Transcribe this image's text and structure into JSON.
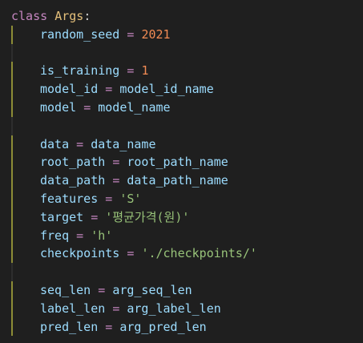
{
  "colors": {
    "background": "#1f1f1f",
    "keyword": "#c586c0",
    "class_name": "#e5c07b",
    "variable": "#9cdcfe",
    "number": "#f28b54",
    "string": "#98c379",
    "indent_guide": "#8c8c36"
  },
  "header": {
    "keyword": "class",
    "name": "Args",
    "colon": ":"
  },
  "lines": [
    {
      "name": "random_seed",
      "value": "2021",
      "type": "num"
    },
    null,
    {
      "name": "is_training",
      "value": "1",
      "type": "num"
    },
    {
      "name": "model_id",
      "value": "model_id_name",
      "type": "var"
    },
    {
      "name": "model",
      "value": "model_name",
      "type": "var"
    },
    null,
    {
      "name": "data",
      "value": "data_name",
      "type": "var"
    },
    {
      "name": "root_path",
      "value": "root_path_name",
      "type": "var"
    },
    {
      "name": "data_path",
      "value": "data_path_name",
      "type": "var"
    },
    {
      "name": "features",
      "value": "'S'",
      "type": "str"
    },
    {
      "name": "target",
      "value": "'평균가격(원)'",
      "type": "str"
    },
    {
      "name": "freq",
      "value": "'h'",
      "type": "str"
    },
    {
      "name": "checkpoints",
      "value": "'./checkpoints/'",
      "type": "str"
    },
    null,
    {
      "name": "seq_len",
      "value": "arg_seq_len",
      "type": "var"
    },
    {
      "name": "label_len",
      "value": "arg_label_len",
      "type": "var"
    },
    {
      "name": "pred_len",
      "value": "arg_pred_len",
      "type": "var"
    }
  ],
  "operator": "="
}
